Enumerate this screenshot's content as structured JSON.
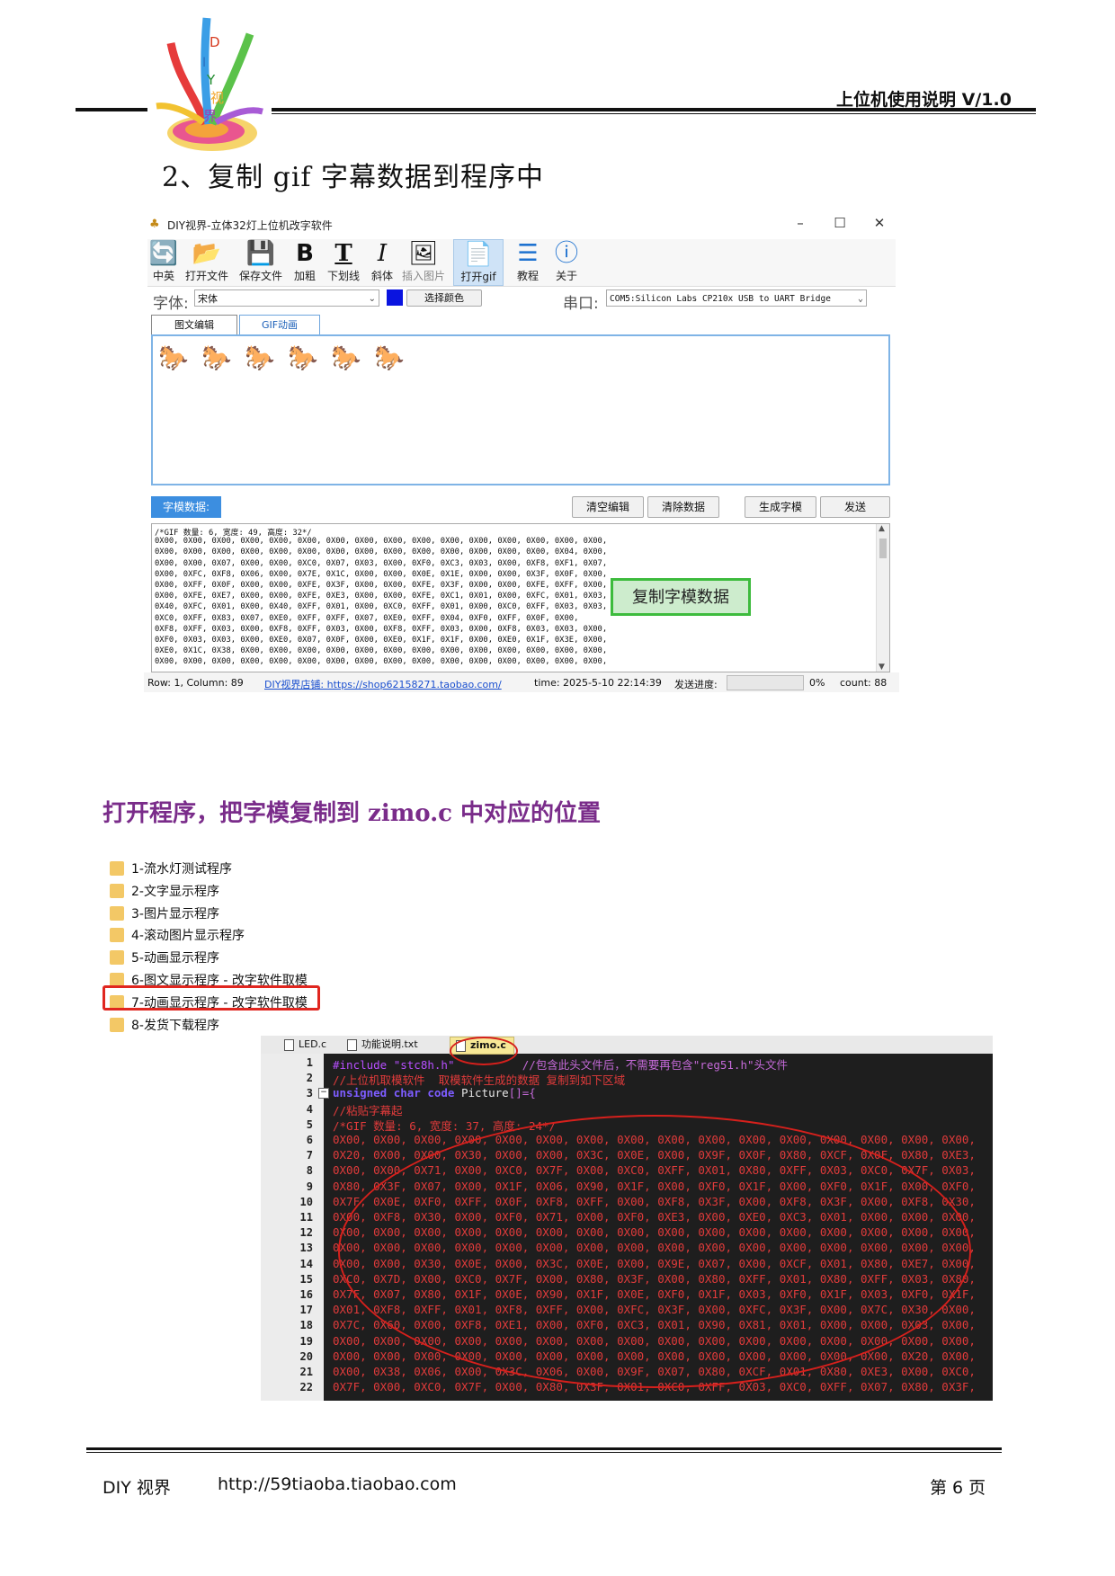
{
  "header": {
    "logo_letters": [
      "D",
      "I",
      "Y",
      "视",
      "界"
    ],
    "doc_title": "上位机使用说明 V/1.0",
    "step_title": "2、复制 gif 字幕数据到程序中"
  },
  "app": {
    "window_title": "DIY视界-立体32灯上位机改字软件",
    "window_buttons": [
      "–",
      "☐",
      "✕"
    ],
    "toolbar": [
      {
        "icon": "lang-icon",
        "glyph": "🔄",
        "label": "中英"
      },
      {
        "icon": "folder-open-icon",
        "glyph": "📂",
        "label": "打开文件"
      },
      {
        "icon": "save-icon",
        "glyph": "💾",
        "label": "保存文件"
      },
      {
        "icon": "bold-icon",
        "glyph": "B",
        "label": "加粗"
      },
      {
        "icon": "underline-icon",
        "glyph": "T",
        "label": "下划线"
      },
      {
        "icon": "italic-icon",
        "glyph": "I",
        "label": "斜体"
      },
      {
        "icon": "image-icon",
        "glyph": "🖼",
        "label": "插入图片"
      },
      {
        "icon": "gif-icon",
        "glyph": "📄",
        "label": "打开gif"
      },
      {
        "icon": "tutorial-icon",
        "glyph": "☰",
        "label": "教程"
      },
      {
        "icon": "info-icon",
        "glyph": "ⓘ",
        "label": "关于"
      }
    ],
    "font_label": "字体:",
    "font_value": "宋体",
    "color_swatch": "#0a14e0",
    "choose_color": "选择颜色",
    "port_label": "串口:",
    "port_value": "COM5:Silicon Labs CP210x USB to UART Bridge",
    "tabs": [
      "图文编辑",
      "GIF动画"
    ],
    "horses": [
      "🐎",
      "🐎",
      "🐎",
      "🐎",
      "🐎",
      "🐎"
    ],
    "zimo_label": "字模数据:",
    "buttons": {
      "clear_edit": "清空编辑",
      "clear_data": "清除数据",
      "generate": "生成字模",
      "send": "发送"
    },
    "zimo_lines": [
      "/*GIF 数量: 6, 宽度: 49, 高度: 32*/",
      "0X00, 0X00, 0X00, 0X00, 0X00, 0X00, 0X00, 0X00, 0X00, 0X00, 0X00, 0X00, 0X00, 0X00, 0X00, 0X00,",
      "0X00, 0X00, 0X00, 0X00, 0X00, 0X00, 0X00, 0X00, 0X00, 0X00, 0X00, 0X00, 0X00, 0X00, 0X04, 0X00,",
      "0X00, 0X00, 0X07, 0X00, 0X00, 0XC0, 0X07, 0X03, 0X00, 0XF0, 0XC3, 0X03, 0X00, 0XF8, 0XF1, 0X07,",
      "0X00, 0XFC, 0XF8, 0X06, 0X00, 0X7E, 0X1C, 0X00, 0X00, 0X0E, 0X1E, 0X00, 0X00, 0X3F, 0X0F, 0X00,",
      "0X00, 0XFF, 0X0F, 0X00, 0X00, 0XFE, 0X3F, 0X00, 0X00, 0XFE, 0X3F, 0X00, 0X00, 0XFE, 0XFF, 0X00,",
      "0X00, 0XFE, 0XE7, 0X00, 0X00, 0XFE, 0XE3, 0X00, 0X00, 0XFE, 0XC1, 0X01, 0X00, 0XFC, 0X01, 0X03,",
      "0X40, 0XFC, 0X01, 0X00, 0X40, 0XFF, 0X01, 0X00, 0XC0, 0XFF, 0X01, 0X00, 0XC0, 0XFF, 0X03, 0X03,",
      "0XC0, 0XFF, 0X83, 0X07, 0XE0, 0XFF, 0XFF, 0X07, 0XE0, 0XFF, 0X04, 0XF0, 0XFF, 0X0F, 0X00,",
      "0XF8, 0XFF, 0X03, 0X00, 0XF8, 0XFF, 0X03, 0X00, 0XF8, 0XFF, 0X03, 0X00, 0XF8, 0X03, 0X03, 0X00,",
      "0XF0, 0X03, 0X03, 0X00, 0XE0, 0X07, 0X0F, 0X00, 0XE0, 0X1F, 0X1F, 0X00, 0XE0, 0X1F, 0X3E, 0X00,",
      "0XE0, 0X1C, 0X38, 0X00, 0X00, 0X00, 0X00, 0X00, 0X00, 0X00, 0X00, 0X00, 0X00, 0X00, 0X00, 0X00,",
      "0X00, 0X00, 0X00, 0X00, 0X00, 0X00, 0X00, 0X00, 0X00, 0X00, 0X00, 0X00, 0X00, 0X00, 0X00, 0X00,"
    ],
    "copy_button": "复制字模数据",
    "status": {
      "row": "Row: 1, Column: 89",
      "shop": "DIY视界店铺: https://shop62158271.taobao.com/",
      "time": "time: 2025-5-10 22:14:39",
      "progress_label": "发送进度:",
      "progress_fraction": 0,
      "percent": "0%",
      "count": "count: 88"
    }
  },
  "instruction": "打开程序，把字模复制到 zimo.c 中对应的位置",
  "folders": [
    {
      "name": "1-流水灯测试程序",
      "highlight": false
    },
    {
      "name": "2-文字显示程序",
      "highlight": false
    },
    {
      "name": "3-图片显示程序",
      "highlight": false
    },
    {
      "name": "4-滚动图片显示程序",
      "highlight": false
    },
    {
      "name": "5-动画显示程序",
      "highlight": false
    },
    {
      "name": "6-图文显示程序 - 改字软件取模",
      "highlight": false
    },
    {
      "name": "7-动画显示程序 - 改字软件取模",
      "highlight": true
    },
    {
      "name": "8-发货下载程序",
      "highlight": false
    }
  ],
  "editor": {
    "tabs": [
      "LED.c",
      "功能说明.txt",
      "zimo.c"
    ],
    "line_numbers": [
      "1",
      "2",
      "3",
      "4",
      "5",
      "6",
      "7",
      "8",
      "9",
      "10",
      "11",
      "12",
      "13",
      "14",
      "15",
      "16",
      "17",
      "18",
      "19",
      "20",
      "21",
      "22"
    ],
    "code": {
      "l1_a": "#include ",
      "l1_b": "\"stc8h.h\"",
      "l1_c": "          //包含此头文件后，不需要再包含\"reg51.h\"头文件",
      "l2": "//上位机取模软件  取模软件生成的数据 复制到如下区域",
      "l3_a": "unsigned char code ",
      "l3_b": "Picture",
      "l3_c": "[]={",
      "l4": "//粘贴字幕起",
      "l5": "/*GIF 数量: 6, 宽度: 37, 高度: 24*/",
      "hex": [
        "0X00, 0X00, 0X00, 0X00, 0X00, 0X00, 0X00, 0X00, 0X00, 0X00, 0X00, 0X00, 0X00, 0X00, 0X00, 0X00,",
        "0X20, 0X00, 0X00, 0X30, 0X00, 0X00, 0X3C, 0X0E, 0X00, 0X9F, 0X0F, 0X80, 0XCF, 0X0F, 0X80, 0XE3,",
        "0X00, 0X00, 0X71, 0X00, 0XC0, 0X7F, 0X00, 0XC0, 0XFF, 0X01, 0X80, 0XFF, 0X03, 0XC0, 0X7F, 0X03,",
        "0X80, 0X3F, 0X07, 0X00, 0X1F, 0X06, 0X90, 0X1F, 0X00, 0XF0, 0X1F, 0X00, 0XF0, 0X1F, 0X00, 0XF0,",
        "0X7F, 0X0E, 0XF0, 0XFF, 0X0F, 0XF8, 0XFF, 0X00, 0XF8, 0X3F, 0X00, 0XF8, 0X3F, 0X00, 0XF8, 0X30,",
        "0X00, 0XF8, 0X30, 0X00, 0XF0, 0X71, 0X00, 0XF0, 0XE3, 0X00, 0XE0, 0XC3, 0X01, 0X00, 0X00, 0X00,",
        "0X00, 0X00, 0X00, 0X00, 0X00, 0X00, 0X00, 0X00, 0X00, 0X00, 0X00, 0X00, 0X00, 0X00, 0X00, 0X00,",
        "0X00, 0X00, 0X00, 0X00, 0X00, 0X00, 0X00, 0X00, 0X00, 0X00, 0X00, 0X00, 0X00, 0X00, 0X00, 0X00,",
        "0X00, 0X00, 0X30, 0X0E, 0X00, 0X3C, 0X0E, 0X00, 0X9E, 0X07, 0X00, 0XCF, 0X01, 0X80, 0XE7, 0X00,",
        "0XC0, 0X7D, 0X00, 0XC0, 0X7F, 0X00, 0X80, 0X3F, 0X00, 0X80, 0XFF, 0X01, 0X80, 0XFF, 0X03, 0X80,",
        "0X7F, 0X07, 0X80, 0X1F, 0X0E, 0X90, 0X1F, 0X0E, 0XF0, 0X1F, 0X03, 0XF0, 0X1F, 0X03, 0XF0, 0X1F,",
        "0X01, 0XF8, 0XFF, 0X01, 0XF8, 0XFF, 0X00, 0XFC, 0X3F, 0X00, 0XFC, 0X3F, 0X00, 0X7C, 0X30, 0X00,",
        "0X7C, 0X60, 0X00, 0XF8, 0XE1, 0X00, 0XF0, 0XC3, 0X01, 0X90, 0X81, 0X01, 0X00, 0X00, 0X03, 0X00,",
        "0X00, 0X00, 0X00, 0X00, 0X00, 0X00, 0X00, 0X00, 0X00, 0X00, 0X00, 0X00, 0X00, 0X00, 0X00, 0X00,",
        "0X00, 0X00, 0X00, 0X00, 0X00, 0X00, 0X00, 0X00, 0X00, 0X00, 0X00, 0X00, 0X00, 0X00, 0X20, 0X00,",
        "0X00, 0X38, 0X06, 0X00, 0X3C, 0X06, 0X00, 0X9F, 0X07, 0X80, 0XCF, 0X01, 0X80, 0XE3, 0X00, 0XC0,",
        "0X7F, 0X00, 0XC0, 0X7F, 0X00, 0X80, 0X3F, 0X01, 0XC0, 0XFF, 0X03, 0XC0, 0XFF, 0X07, 0X80, 0X3F,"
      ]
    }
  },
  "footer": {
    "brand": "DIY 视界",
    "url": "http://59tiaoba.tiaobao.com",
    "page": "第 6 页"
  }
}
